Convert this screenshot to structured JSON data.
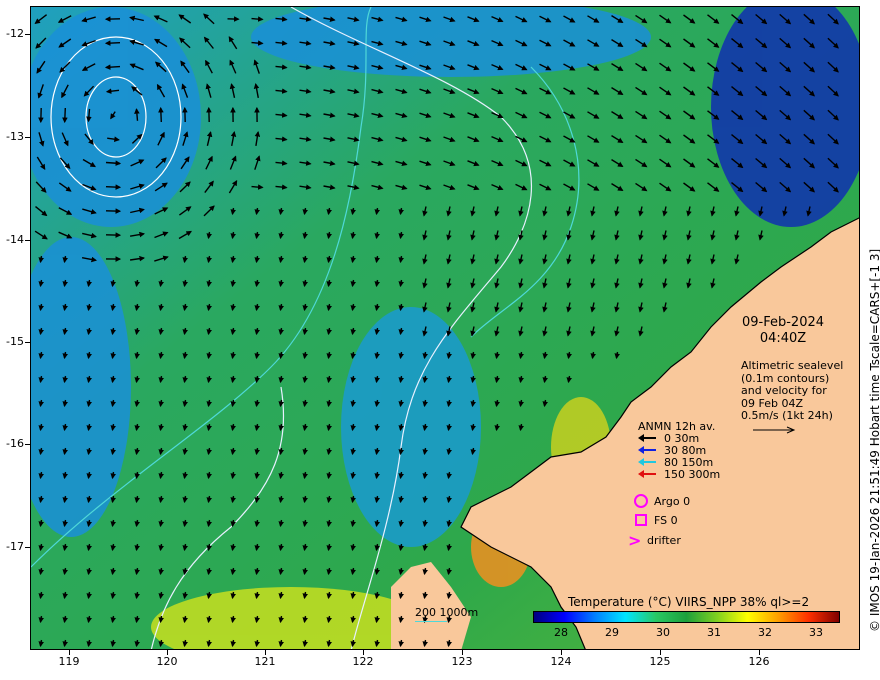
{
  "map": {
    "lon_range": [
      118.5,
      127
    ],
    "lat_range": [
      -18,
      -11.7
    ],
    "x_ticks": [
      "119",
      "120",
      "121",
      "122",
      "123",
      "124",
      "125",
      "126"
    ],
    "y_ticks": [
      "-12",
      "-13",
      "-14",
      "-15",
      "-16",
      "-17"
    ],
    "land_color": "#f9c89b",
    "ocean_color": "#2ea84a"
  },
  "date_label": {
    "line1": "09-Feb-2024",
    "line2": "04:40Z"
  },
  "info": {
    "line1": "Altimetric sealevel",
    "line2": "(0.1m contours)",
    "line3": "and velocity for",
    "line4": "09 Feb 04Z",
    "line5": "0.5m/s (1kt 24h)"
  },
  "legend": {
    "title": "ANMN 12h av.",
    "items": [
      {
        "label": "0 30m",
        "color": "#000000"
      },
      {
        "label": "30 80m",
        "color": "#1020e0"
      },
      {
        "label": "80 150m",
        "color": "#20c8e0"
      },
      {
        "label": "150 300m",
        "color": "#e01010"
      }
    ],
    "argo": "Argo 0",
    "fs": "FS 0",
    "drifter": "drifter",
    "drifter_symbol": ">",
    "marker_color": "#ff00ff"
  },
  "colorbar": {
    "title": "Temperature (°C) VIIRS_NPP 38% ql>=2",
    "ticks": [
      "28",
      "29",
      "30",
      "31",
      "32",
      "33"
    ],
    "colors": [
      "#00007f",
      "#0000ff",
      "#007fff",
      "#00e5ff",
      "#29c864",
      "#1ea03c",
      "#7fd020",
      "#ffff00",
      "#ff9f00",
      "#ff3000",
      "#7f0000"
    ]
  },
  "scale": {
    "contours_label": "200  1000m"
  },
  "credit": "© IMOS 19-Jan-2026 21:51:49 Hobart time Tscale=CARS+[-1 3]"
}
